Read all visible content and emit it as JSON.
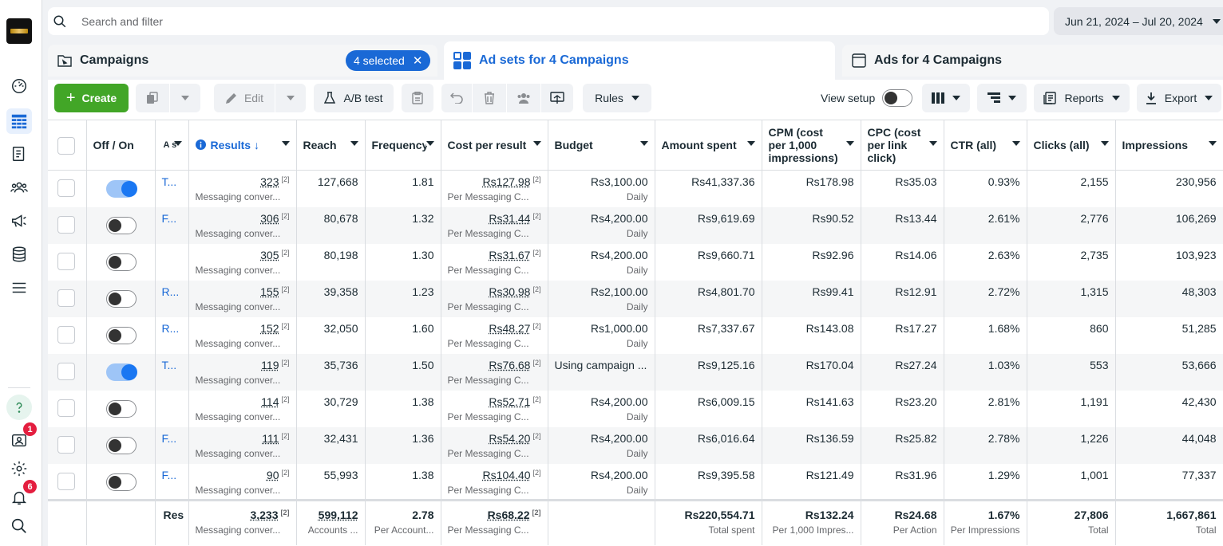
{
  "search": {
    "placeholder": "Search and filter"
  },
  "date_range": "Jun 21, 2024 – Jul 20, 2024",
  "tabs": {
    "campaigns": "Campaigns",
    "selected": "4 selected",
    "adsets": "Ad sets for 4 Campaigns",
    "ads": "Ads for 4 Campaigns"
  },
  "toolbar": {
    "create": "Create",
    "edit": "Edit",
    "ab_test": "A/B test",
    "rules": "Rules",
    "view_setup": "View setup",
    "reports": "Reports",
    "export": "Export"
  },
  "badges": {
    "notifications_inbox": "1",
    "alerts": "6"
  },
  "columns": {
    "offon": "Off / On",
    "name": "A s",
    "results": "Results",
    "reach": "Reach",
    "frequency": "Frequency",
    "cpr": "Cost per result",
    "budget": "Budget",
    "amount": "Amount spent",
    "cpm": "CPM (cost per 1,000 impressions)",
    "cpc": "CPC (cost per link click)",
    "ctr": "CTR (all)",
    "clicks": "Clicks (all)",
    "impressions": "Impressions"
  },
  "rows": [
    {
      "on": true,
      "name": "T...",
      "results": "323",
      "results_sub": "Messaging conver...",
      "reach": "127,668",
      "frequency": "1.81",
      "cpr": "Rs127.98",
      "cpr_sub": "Per Messaging C...",
      "budget": "Rs3,100.00",
      "budget_sub": "Daily",
      "amount": "Rs41,337.36",
      "cpm": "Rs178.98",
      "cpc": "Rs35.03",
      "ctr": "0.93%",
      "clicks": "2,155",
      "impressions": "230,956"
    },
    {
      "on": false,
      "name": "F...",
      "results": "306",
      "results_sub": "Messaging conver...",
      "reach": "80,678",
      "frequency": "1.32",
      "cpr": "Rs31.44",
      "cpr_sub": "Per Messaging C...",
      "budget": "Rs4,200.00",
      "budget_sub": "Daily",
      "amount": "Rs9,619.69",
      "cpm": "Rs90.52",
      "cpc": "Rs13.44",
      "ctr": "2.61%",
      "clicks": "2,776",
      "impressions": "106,269"
    },
    {
      "on": false,
      "name": "",
      "results": "305",
      "results_sub": "Messaging conver...",
      "reach": "80,198",
      "frequency": "1.30",
      "cpr": "Rs31.67",
      "cpr_sub": "Per Messaging C...",
      "budget": "Rs4,200.00",
      "budget_sub": "Daily",
      "amount": "Rs9,660.71",
      "cpm": "Rs92.96",
      "cpc": "Rs14.06",
      "ctr": "2.63%",
      "clicks": "2,735",
      "impressions": "103,923"
    },
    {
      "on": false,
      "name": "R...",
      "results": "155",
      "results_sub": "Messaging conver...",
      "reach": "39,358",
      "frequency": "1.23",
      "cpr": "Rs30.98",
      "cpr_sub": "Per Messaging C...",
      "budget": "Rs2,100.00",
      "budget_sub": "Daily",
      "amount": "Rs4,801.70",
      "cpm": "Rs99.41",
      "cpc": "Rs12.91",
      "ctr": "2.72%",
      "clicks": "1,315",
      "impressions": "48,303"
    },
    {
      "on": false,
      "name": "R...",
      "results": "152",
      "results_sub": "Messaging conver...",
      "reach": "32,050",
      "frequency": "1.60",
      "cpr": "Rs48.27",
      "cpr_sub": "Per Messaging C...",
      "budget": "Rs1,000.00",
      "budget_sub": "Daily",
      "amount": "Rs7,337.67",
      "cpm": "Rs143.08",
      "cpc": "Rs17.27",
      "ctr": "1.68%",
      "clicks": "860",
      "impressions": "51,285"
    },
    {
      "on": true,
      "name": "T...",
      "results": "119",
      "results_sub": "Messaging conver...",
      "reach": "35,736",
      "frequency": "1.50",
      "cpr": "Rs76.68",
      "cpr_sub": "Per Messaging C...",
      "budget": "Using campaign ...",
      "budget_sub": "",
      "amount": "Rs9,125.16",
      "cpm": "Rs170.04",
      "cpc": "Rs27.24",
      "ctr": "1.03%",
      "clicks": "553",
      "impressions": "53,666"
    },
    {
      "on": false,
      "name": "",
      "results": "114",
      "results_sub": "Messaging conver...",
      "reach": "30,729",
      "frequency": "1.38",
      "cpr": "Rs52.71",
      "cpr_sub": "Per Messaging C...",
      "budget": "Rs4,200.00",
      "budget_sub": "Daily",
      "amount": "Rs6,009.15",
      "cpm": "Rs141.63",
      "cpc": "Rs23.20",
      "ctr": "2.81%",
      "clicks": "1,191",
      "impressions": "42,430"
    },
    {
      "on": false,
      "name": "F...",
      "results": "111",
      "results_sub": "Messaging conver...",
      "reach": "32,431",
      "frequency": "1.36",
      "cpr": "Rs54.20",
      "cpr_sub": "Per Messaging C...",
      "budget": "Rs4,200.00",
      "budget_sub": "Daily",
      "amount": "Rs6,016.64",
      "cpm": "Rs136.59",
      "cpc": "Rs25.82",
      "ctr": "2.78%",
      "clicks": "1,226",
      "impressions": "44,048"
    },
    {
      "on": false,
      "name": "F...",
      "results": "90",
      "results_sub": "Messaging conver...",
      "reach": "55,993",
      "frequency": "1.38",
      "cpr": "Rs104.40",
      "cpr_sub": "Per Messaging C...",
      "budget": "Rs4,200.00",
      "budget_sub": "Daily",
      "amount": "Rs9,395.58",
      "cpm": "Rs121.49",
      "cpc": "Rs31.96",
      "ctr": "1.29%",
      "clicks": "1,001",
      "impressions": "77,337"
    }
  ],
  "sup_mark": "[2]",
  "totals": {
    "label": "Res",
    "results": "3,233",
    "results_sub": "Messaging conver...",
    "reach": "599,112",
    "reach_sub": "Accounts ...",
    "frequency": "2.78",
    "frequency_sub": "Per Account...",
    "cpr": "Rs68.22",
    "cpr_sub": "Per Messaging C...",
    "amount": "Rs220,554.71",
    "amount_sub": "Total spent",
    "cpm": "Rs132.24",
    "cpm_sub": "Per 1,000 Impres...",
    "cpc": "Rs24.68",
    "cpc_sub": "Per Action",
    "ctr": "1.67%",
    "ctr_sub": "Per Impressions",
    "clicks": "27,806",
    "clicks_sub": "Total",
    "impressions": "1,667,861",
    "impressions_sub": "Total"
  }
}
